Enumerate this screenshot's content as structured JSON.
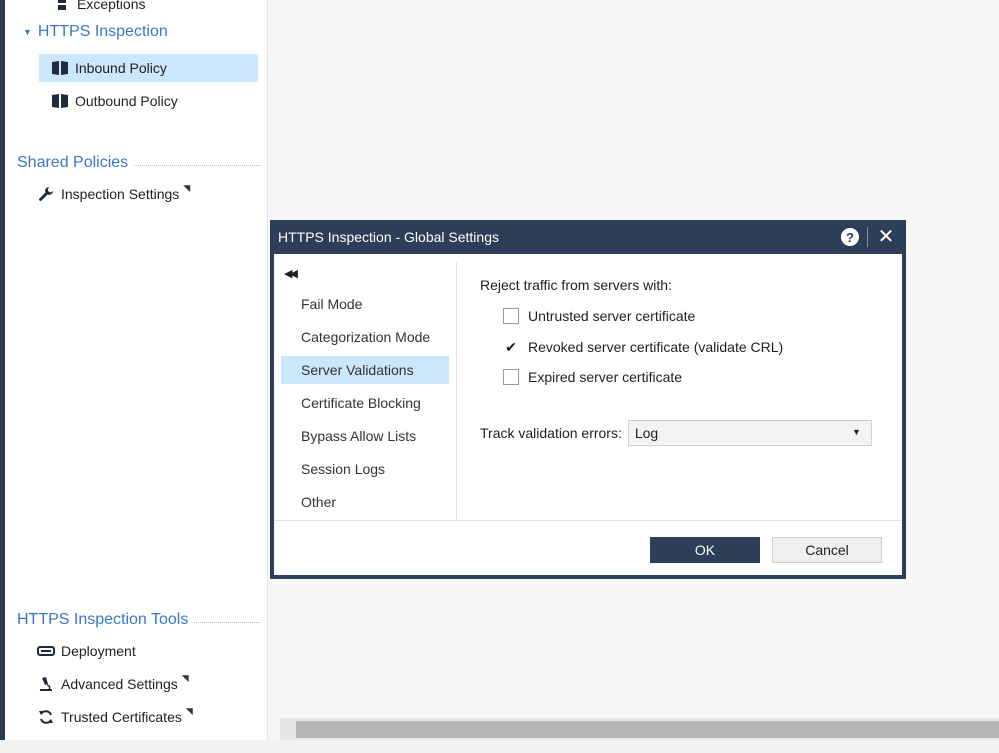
{
  "sidebar": {
    "exceptions_label": "Exceptions",
    "https_inspection": {
      "title": "HTTPS Inspection",
      "inbound_label": "Inbound Policy",
      "outbound_label": "Outbound Policy"
    },
    "shared_policies": {
      "title": "Shared Policies",
      "inspection_settings_label": "Inspection Settings"
    },
    "tools": {
      "title": "HTTPS Inspection Tools",
      "deployment_label": "Deployment",
      "advanced_settings_label": "Advanced Settings",
      "trusted_certificates_label": "Trusted Certificates"
    }
  },
  "dialog": {
    "title": "HTTPS Inspection - Global Settings",
    "help_glyph": "?",
    "close_glyph": "✕",
    "nav_items": [
      {
        "label": "Fail Mode"
      },
      {
        "label": "Categorization Mode"
      },
      {
        "label": "Server Validations",
        "selected": true
      },
      {
        "label": "Certificate Blocking"
      },
      {
        "label": "Bypass Allow Lists"
      },
      {
        "label": "Session Logs"
      },
      {
        "label": "Other"
      }
    ],
    "reject_label": "Reject traffic from servers with:",
    "checkboxes": [
      {
        "label": "Untrusted server certificate",
        "checked": false
      },
      {
        "label": "Revoked server certificate (validate CRL)",
        "checked": true
      },
      {
        "label": "Expired server certificate",
        "checked": false
      }
    ],
    "track_label": "Track validation errors:",
    "track_value": "Log",
    "ok_label": "OK",
    "cancel_label": "Cancel"
  },
  "colors": {
    "accent": "#3a78c6",
    "dialog_frame": "#2c3e58",
    "selection": "#cce6fb"
  }
}
